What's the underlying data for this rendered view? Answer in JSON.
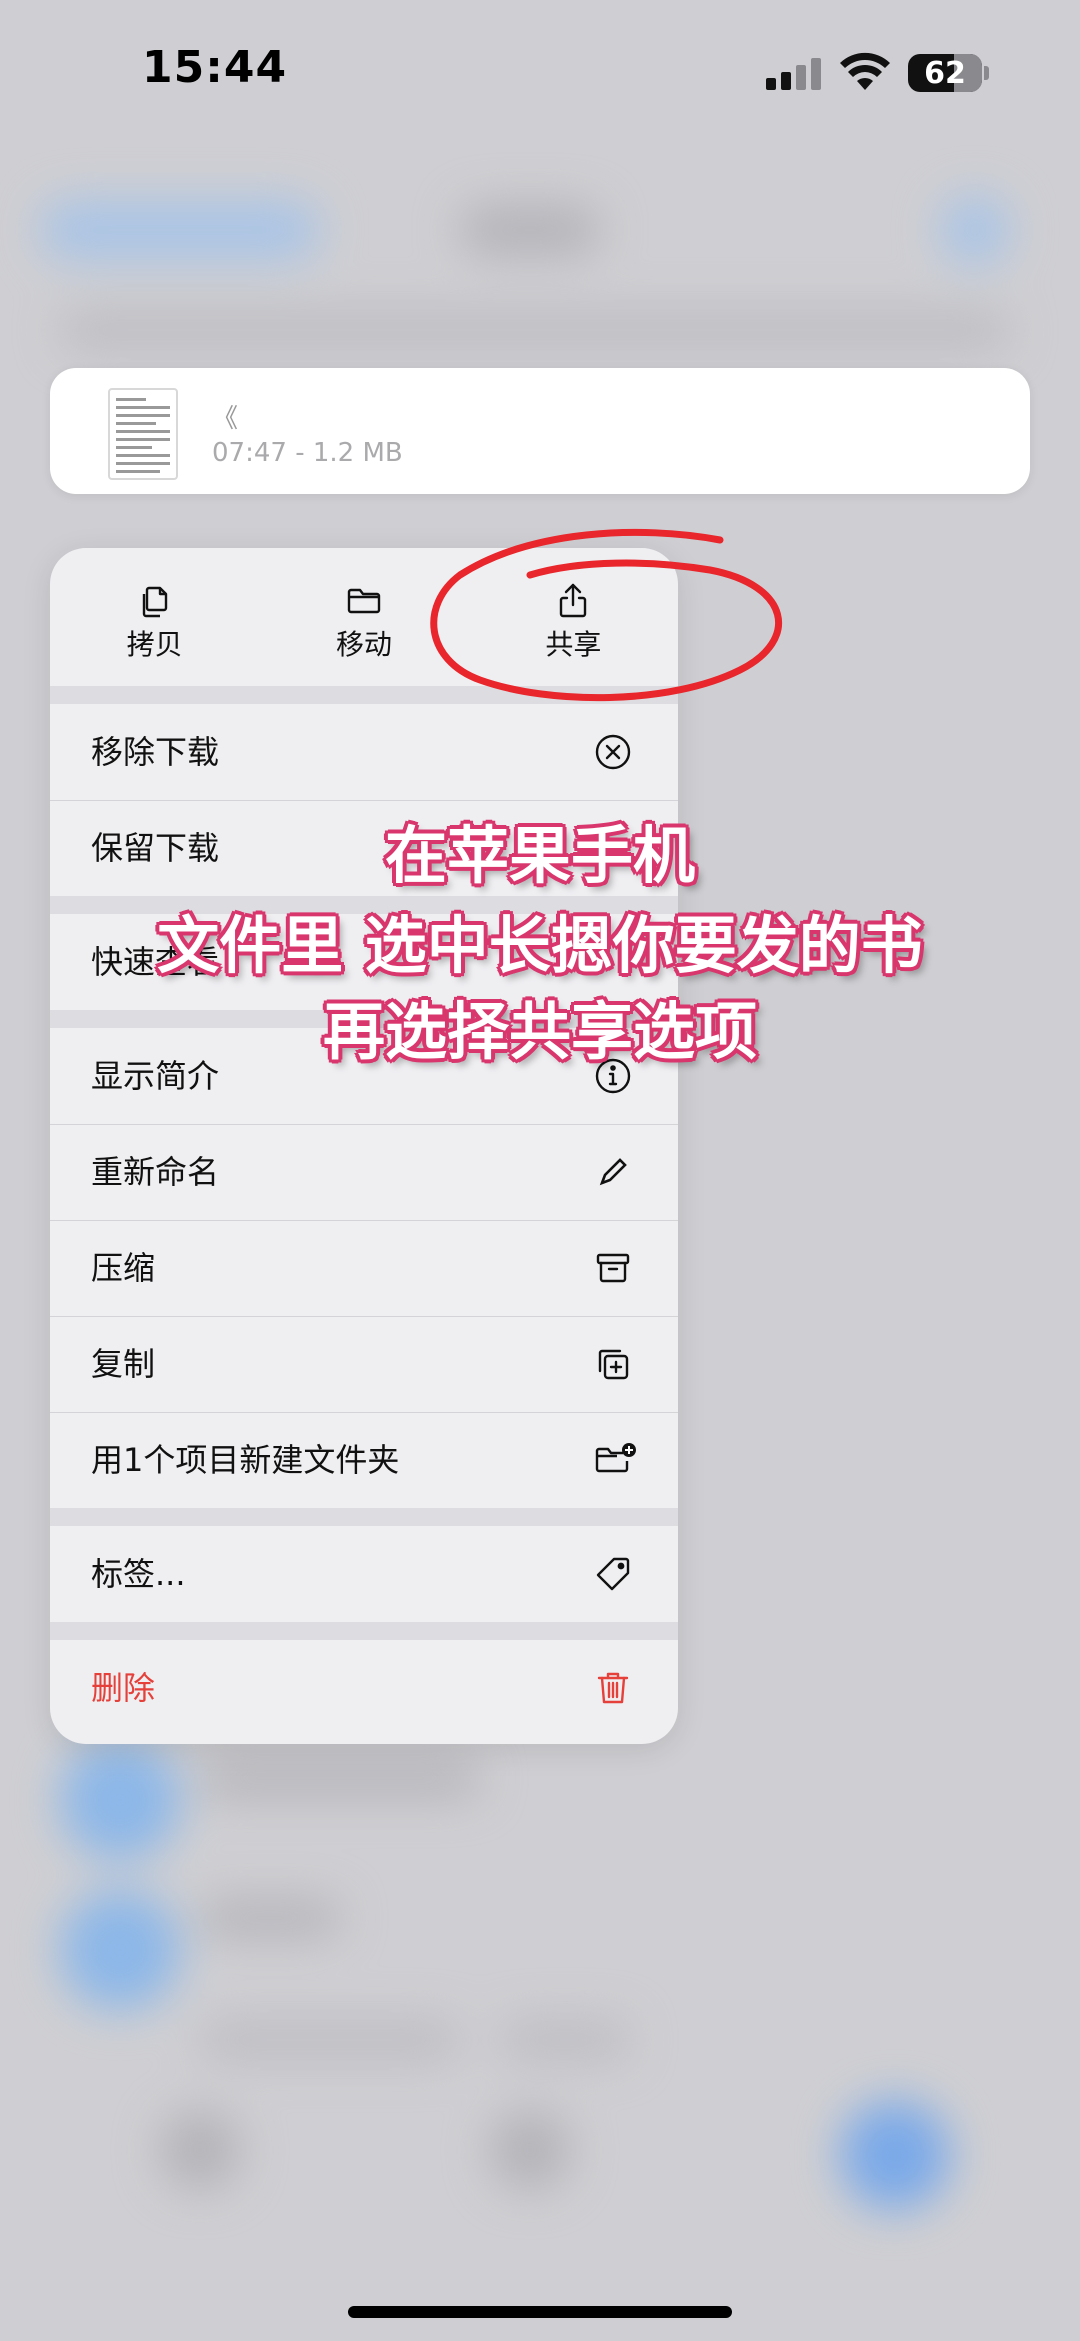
{
  "status_bar": {
    "time": "15:44",
    "battery": "62"
  },
  "file": {
    "name": "《",
    "meta": "07:47 - 1.2 MB"
  },
  "menu": {
    "top_actions": [
      {
        "label": "拷贝",
        "icon": "copy-doc-icon"
      },
      {
        "label": "移动",
        "icon": "folder-icon"
      },
      {
        "label": "共享",
        "icon": "share-icon"
      }
    ],
    "groups": [
      [
        {
          "label": "移除下载",
          "icon": "circle-x-icon"
        },
        {
          "label": "保留下载",
          "icon": ""
        }
      ],
      [
        {
          "label": "快速查看",
          "icon": ""
        }
      ],
      [
        {
          "label": "显示简介",
          "icon": "info-icon"
        },
        {
          "label": "重新命名",
          "icon": "pencil-icon"
        },
        {
          "label": "压缩",
          "icon": "archive-box-icon"
        },
        {
          "label": "复制",
          "icon": "duplicate-icon"
        },
        {
          "label": "用1个项目新建文件夹",
          "icon": "folder-plus-icon"
        }
      ],
      [
        {
          "label": "标签...",
          "icon": "tag-icon"
        }
      ],
      [
        {
          "label": "删除",
          "icon": "trash-icon",
          "destructive": true
        }
      ]
    ],
    "danger_color": "#e5403a"
  },
  "annotation": {
    "lines": [
      "在苹果手机",
      "文件里 选中长摁你要发的书",
      "再选择共享选项"
    ],
    "text_color": "#ffffff",
    "outline_color": "#d8366c",
    "circle_color": "#e8262b"
  }
}
